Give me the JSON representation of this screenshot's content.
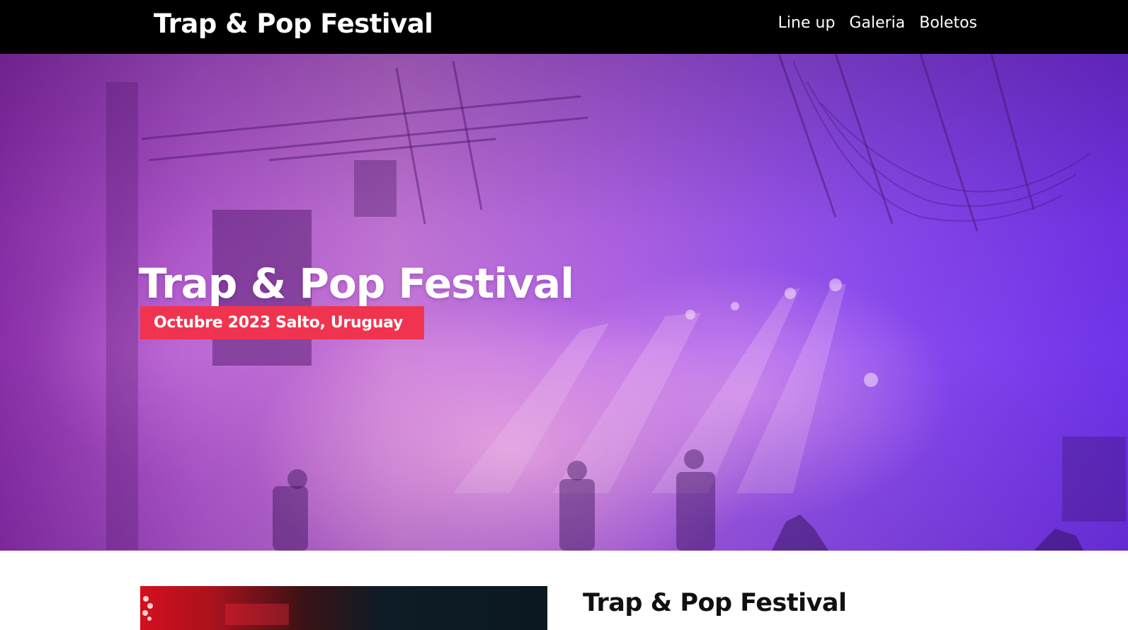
{
  "header": {
    "logo": "Trap & Pop Festival",
    "nav": [
      {
        "label": "Line up"
      },
      {
        "label": "Galeria"
      },
      {
        "label": "Boletos"
      }
    ]
  },
  "hero": {
    "title": "Trap & Pop Festival",
    "badge": "Octubre 2023 Salto, Uruguay"
  },
  "about": {
    "title": "Trap & Pop Festival"
  },
  "colors": {
    "header_bg": "#000000",
    "badge_bg": "#f0344f",
    "hero_tint": "#a855e0"
  }
}
